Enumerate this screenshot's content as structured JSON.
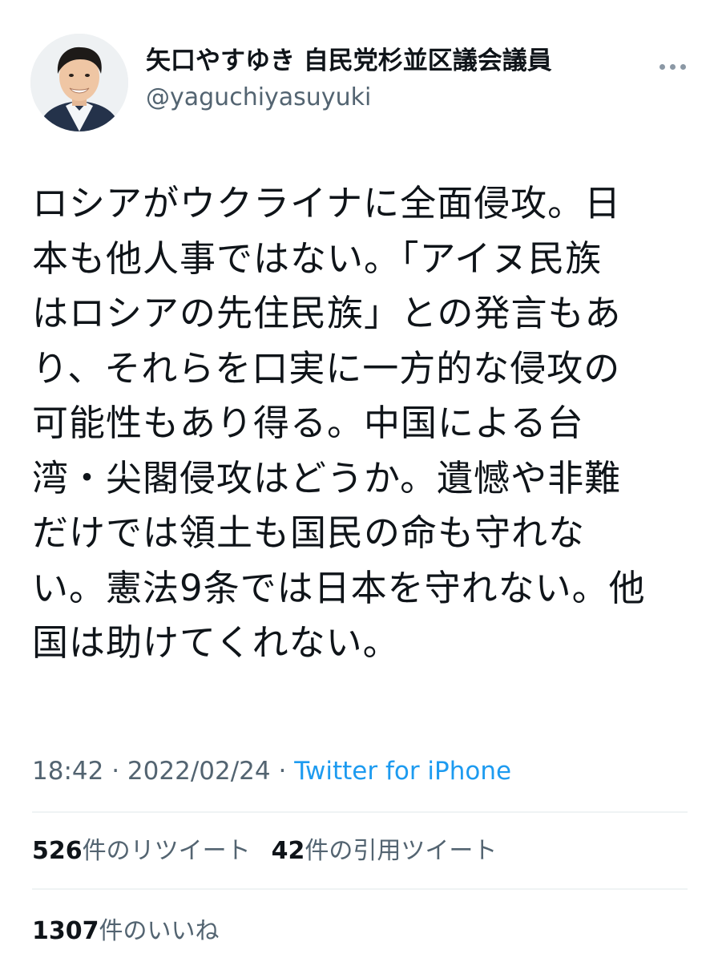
{
  "author": {
    "display_name": "矢口やすゆき 自民党杉並区議会議員",
    "handle": "@yaguchiyasuyuki"
  },
  "tweet": {
    "text": "ロシアがウクライナに全面侵攻。日\n本も他人事ではない。「アイヌ民族\nはロシアの先住民族」との発言もあ\nり、それらを口実に一方的な侵攻の\n可能性もあり得る。中国による台\n湾・尖閣侵攻はどうか。遺憾や非難\nだけでは領土も国民の命も守れな\nい。憲法9条では日本を守れない。他\n国は助けてくれない。",
    "time": "18:42",
    "separator": "·",
    "date": "2022/02/24",
    "source": "Twitter for iPhone"
  },
  "stats": {
    "retweets_count": "526",
    "retweets_label": "件のリツイート",
    "quotes_count": "42",
    "quotes_label": "件の引用ツイート",
    "likes_count": "1307",
    "likes_label": "件のいいね"
  },
  "icons": {
    "more": "more-horizontal-icon",
    "avatar": "profile-photo"
  },
  "colors": {
    "text_primary": "#0f1419",
    "text_secondary": "#536471",
    "link": "#1d9bf0",
    "divider": "#eff3f4"
  }
}
